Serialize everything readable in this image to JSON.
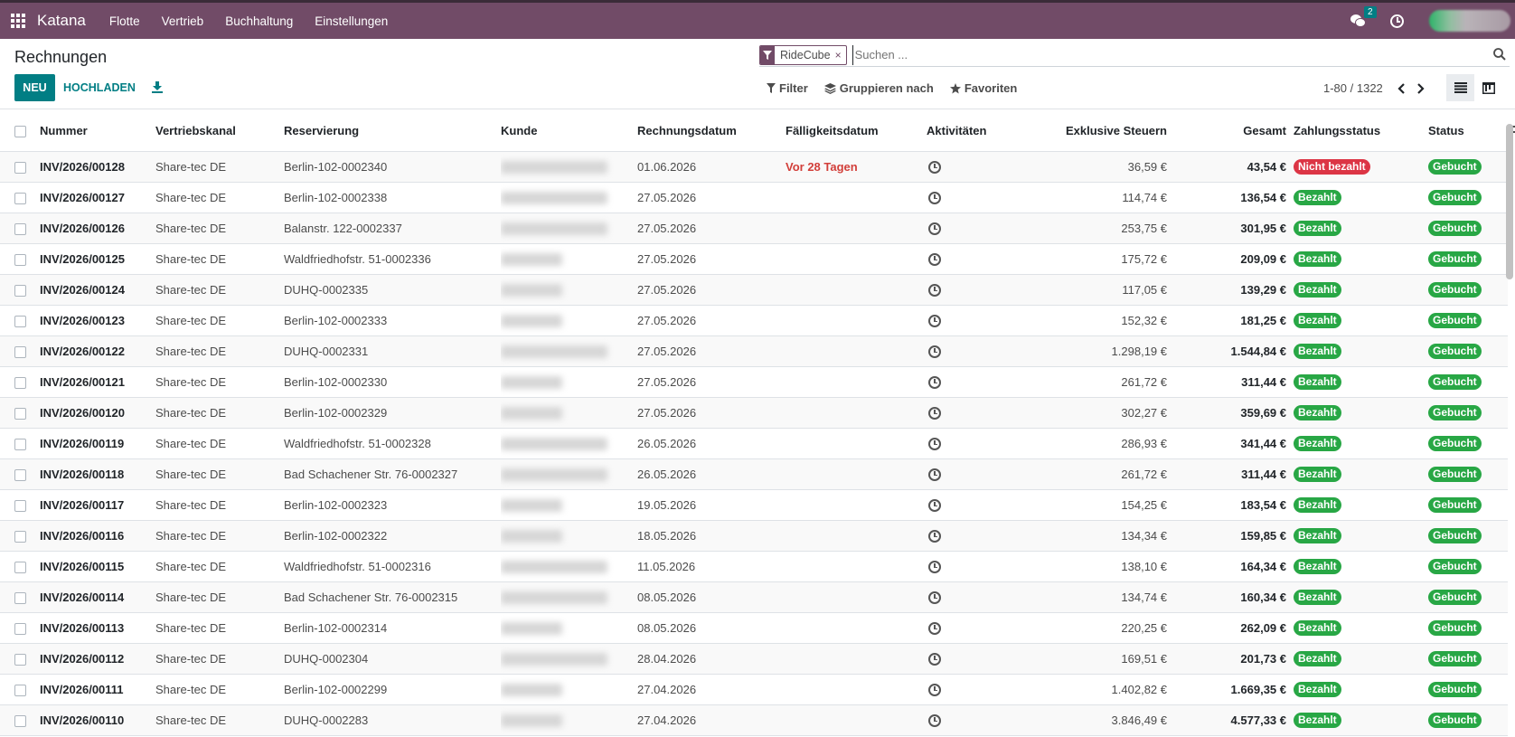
{
  "navbar": {
    "brand": "Katana",
    "menu": [
      "Flotte",
      "Vertrieb",
      "Buchhaltung",
      "Einstellungen"
    ],
    "chat_count": "2",
    "color": "#714B67"
  },
  "control_panel": {
    "title": "Rechnungen",
    "new_label": "NEU",
    "upload_label": "HOCHLADEN",
    "search": {
      "facet": "RideCube",
      "placeholder": "Suchen ..."
    },
    "filter_label": "Filter",
    "groupby_label": "Gruppieren nach",
    "favorites_label": "Favoriten",
    "pager": "1-80 / 1322"
  },
  "table": {
    "columns": [
      "Nummer",
      "Vertriebskanal",
      "Reservierung",
      "Kunde",
      "Rechnungsdatum",
      "Fälligkeitsdatum",
      "Aktivitäten",
      "Exklusive Steuern",
      "Gesamt",
      "Zahlungsstatus",
      "Status"
    ],
    "rows": [
      {
        "number": "INV/2026/00128",
        "channel": "Share-tec DE",
        "reservation": "Berlin-102-0002340",
        "date": "01.06.2026",
        "due": "Vor 28 Tagen",
        "untaxed": "36,59 €",
        "total": "43,54 €",
        "payment": "Nicht bezahlt",
        "status": "Gebucht"
      },
      {
        "number": "INV/2026/00127",
        "channel": "Share-tec DE",
        "reservation": "Berlin-102-0002338",
        "date": "27.05.2026",
        "due": "",
        "untaxed": "114,74 €",
        "total": "136,54 €",
        "payment": "Bezahlt",
        "status": "Gebucht"
      },
      {
        "number": "INV/2026/00126",
        "channel": "Share-tec DE",
        "reservation": "Balanstr. 122-0002337",
        "date": "27.05.2026",
        "due": "",
        "untaxed": "253,75 €",
        "total": "301,95 €",
        "payment": "Bezahlt",
        "status": "Gebucht"
      },
      {
        "number": "INV/2026/00125",
        "channel": "Share-tec DE",
        "reservation": "Waldfriedhofstr. 51-0002336",
        "date": "27.05.2026",
        "due": "",
        "untaxed": "175,72 €",
        "total": "209,09 €",
        "payment": "Bezahlt",
        "status": "Gebucht"
      },
      {
        "number": "INV/2026/00124",
        "channel": "Share-tec DE",
        "reservation": "DUHQ-0002335",
        "date": "27.05.2026",
        "due": "",
        "untaxed": "117,05 €",
        "total": "139,29 €",
        "payment": "Bezahlt",
        "status": "Gebucht"
      },
      {
        "number": "INV/2026/00123",
        "channel": "Share-tec DE",
        "reservation": "Berlin-102-0002333",
        "date": "27.05.2026",
        "due": "",
        "untaxed": "152,32 €",
        "total": "181,25 €",
        "payment": "Bezahlt",
        "status": "Gebucht"
      },
      {
        "number": "INV/2026/00122",
        "channel": "Share-tec DE",
        "reservation": "DUHQ-0002331",
        "date": "27.05.2026",
        "due": "",
        "untaxed": "1.298,19 €",
        "total": "1.544,84 €",
        "payment": "Bezahlt",
        "status": "Gebucht"
      },
      {
        "number": "INV/2026/00121",
        "channel": "Share-tec DE",
        "reservation": "Berlin-102-0002330",
        "date": "27.05.2026",
        "due": "",
        "untaxed": "261,72 €",
        "total": "311,44 €",
        "payment": "Bezahlt",
        "status": "Gebucht"
      },
      {
        "number": "INV/2026/00120",
        "channel": "Share-tec DE",
        "reservation": "Berlin-102-0002329",
        "date": "27.05.2026",
        "due": "",
        "untaxed": "302,27 €",
        "total": "359,69 €",
        "payment": "Bezahlt",
        "status": "Gebucht"
      },
      {
        "number": "INV/2026/00119",
        "channel": "Share-tec DE",
        "reservation": "Waldfriedhofstr. 51-0002328",
        "date": "26.05.2026",
        "due": "",
        "untaxed": "286,93 €",
        "total": "341,44 €",
        "payment": "Bezahlt",
        "status": "Gebucht"
      },
      {
        "number": "INV/2026/00118",
        "channel": "Share-tec DE",
        "reservation": "Bad Schachener Str. 76-0002327",
        "date": "26.05.2026",
        "due": "",
        "untaxed": "261,72 €",
        "total": "311,44 €",
        "payment": "Bezahlt",
        "status": "Gebucht"
      },
      {
        "number": "INV/2026/00117",
        "channel": "Share-tec DE",
        "reservation": "Berlin-102-0002323",
        "date": "19.05.2026",
        "due": "",
        "untaxed": "154,25 €",
        "total": "183,54 €",
        "payment": "Bezahlt",
        "status": "Gebucht"
      },
      {
        "number": "INV/2026/00116",
        "channel": "Share-tec DE",
        "reservation": "Berlin-102-0002322",
        "date": "18.05.2026",
        "due": "",
        "untaxed": "134,34 €",
        "total": "159,85 €",
        "payment": "Bezahlt",
        "status": "Gebucht"
      },
      {
        "number": "INV/2026/00115",
        "channel": "Share-tec DE",
        "reservation": "Waldfriedhofstr. 51-0002316",
        "date": "11.05.2026",
        "due": "",
        "untaxed": "138,10 €",
        "total": "164,34 €",
        "payment": "Bezahlt",
        "status": "Gebucht"
      },
      {
        "number": "INV/2026/00114",
        "channel": "Share-tec DE",
        "reservation": "Bad Schachener Str. 76-0002315",
        "date": "08.05.2026",
        "due": "",
        "untaxed": "134,74 €",
        "total": "160,34 €",
        "payment": "Bezahlt",
        "status": "Gebucht"
      },
      {
        "number": "INV/2026/00113",
        "channel": "Share-tec DE",
        "reservation": "Berlin-102-0002314",
        "date": "08.05.2026",
        "due": "",
        "untaxed": "220,25 €",
        "total": "262,09 €",
        "payment": "Bezahlt",
        "status": "Gebucht"
      },
      {
        "number": "INV/2026/00112",
        "channel": "Share-tec DE",
        "reservation": "DUHQ-0002304",
        "date": "28.04.2026",
        "due": "",
        "untaxed": "169,51 €",
        "total": "201,73 €",
        "payment": "Bezahlt",
        "status": "Gebucht"
      },
      {
        "number": "INV/2026/00111",
        "channel": "Share-tec DE",
        "reservation": "Berlin-102-0002299",
        "date": "27.04.2026",
        "due": "",
        "untaxed": "1.402,82 €",
        "total": "1.669,35 €",
        "payment": "Bezahlt",
        "status": "Gebucht"
      },
      {
        "number": "INV/2026/00110",
        "channel": "Share-tec DE",
        "reservation": "DUHQ-0002283",
        "date": "27.04.2026",
        "due": "",
        "untaxed": "3.846,49 €",
        "total": "4.577,33 €",
        "payment": "Bezahlt",
        "status": "Gebucht"
      }
    ]
  },
  "colors": {
    "primary": "#714B67",
    "accent": "#017e84",
    "paid": "#28a745",
    "unpaid": "#dc3545",
    "overdue": "#d23f3a"
  }
}
